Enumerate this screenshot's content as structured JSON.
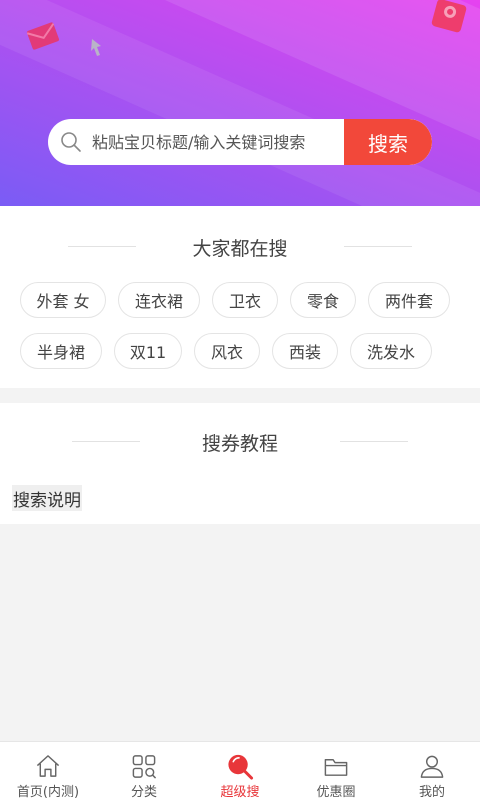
{
  "search": {
    "placeholder": "粘贴宝贝标题/输入关键词搜索",
    "button_label": "搜索"
  },
  "hot": {
    "title": "大家都在搜",
    "tags": [
      "外套 女",
      "连衣裙",
      "卫衣",
      "零食",
      "两件套",
      "半身裙",
      "双11",
      "风衣",
      "西装",
      "洗发水"
    ]
  },
  "tutorial": {
    "title": "搜券教程",
    "explain_label": "搜索说明"
  },
  "tabbar": {
    "items": [
      {
        "label": "首页(内测)",
        "icon": "home-icon"
      },
      {
        "label": "分类",
        "icon": "category-grid-icon"
      },
      {
        "label": "超级搜",
        "icon": "super-search-icon",
        "active": true
      },
      {
        "label": "优惠圈",
        "icon": "folder-icon"
      },
      {
        "label": "我的",
        "icon": "user-icon"
      }
    ]
  },
  "colors": {
    "accent": "#f2483a",
    "active_tab": "#e8363a",
    "hero_start": "#e642f0",
    "hero_end": "#7a5cf5"
  }
}
